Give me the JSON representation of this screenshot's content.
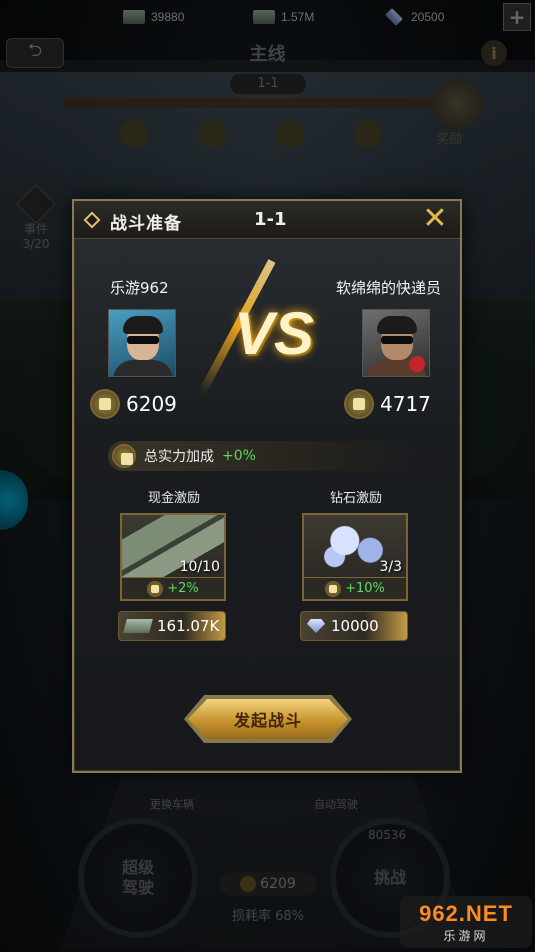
{
  "topbar": {
    "cash_value": "39880",
    "power_value": "1.57M",
    "gem_value": "20500",
    "plus_label": "+"
  },
  "header": {
    "title": "主线",
    "stage": "1-1",
    "reward_label": "奖励",
    "side_label_1": "事件",
    "side_label_2": "3/20"
  },
  "dialog": {
    "title": "战斗准备",
    "stage": "1-1",
    "close_label": "✕",
    "vs_label": "VS",
    "player": {
      "name": "乐游962",
      "power": "6209"
    },
    "opponent": {
      "name": "软绵绵的快递员",
      "power": "4717"
    },
    "bonus": {
      "label": "总实力加成",
      "value": "+0%"
    },
    "cash_reward": {
      "title": "现金激励",
      "count": "10/10",
      "bonus": "+2%",
      "cost": "161.07K"
    },
    "gem_reward": {
      "title": "钻石激励",
      "count": "3/3",
      "bonus": "+10%",
      "cost": "10000"
    },
    "fight_button": "发起战斗"
  },
  "bottom": {
    "label_left": "更换车辆",
    "label_right": "自动驾驶",
    "left_button": "超级\n驾驶",
    "right_button": "挑战",
    "power": "6209",
    "loss_rate": "损耗率 68%",
    "right_stat": "80536"
  },
  "watermark": {
    "logo": "962.NET",
    "site": "乐游网"
  },
  "colors": {
    "accent_gold": "#e3b94f",
    "bonus_green": "#5fd85f",
    "dialog_border": "#8a7a52"
  }
}
